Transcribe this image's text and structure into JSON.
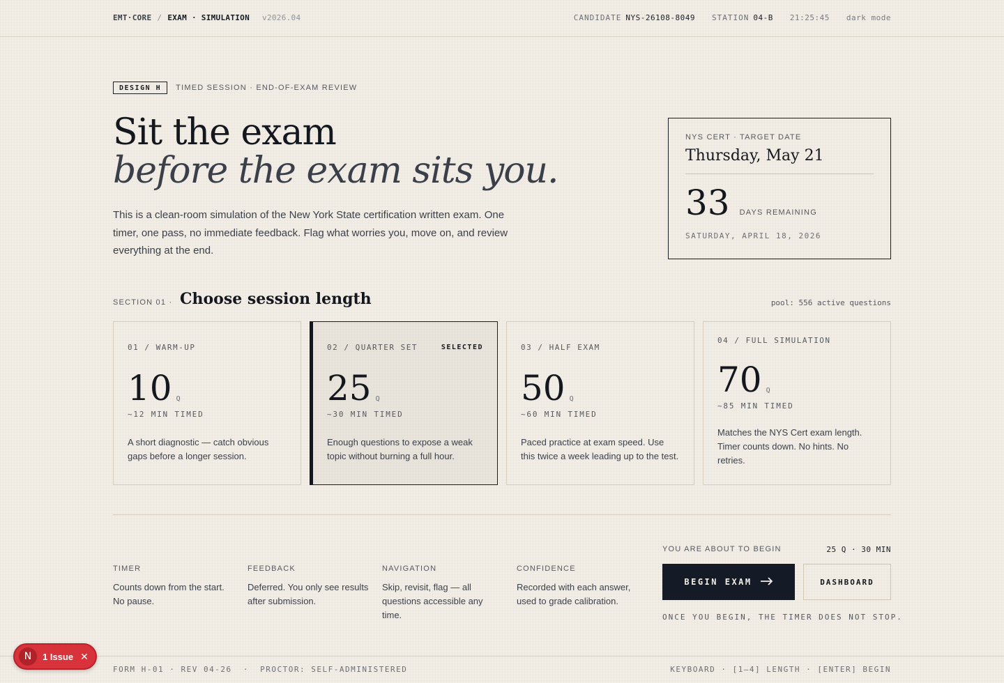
{
  "topbar": {
    "brand": "EMT·CORE",
    "sep": "/",
    "crumb": "EXAM · SIMULATION",
    "version": "v2026.04",
    "candidate_label": "CANDIDATE",
    "candidate_value": "NYS-26108-8049",
    "station_label": "STATION",
    "station_value": "04-B",
    "time": "21:25:45",
    "dark_mode": "dark mode"
  },
  "hero": {
    "tag": "DESIGN H",
    "tagline": "TIMED SESSION · END-OF-EXAM REVIEW",
    "title_line1": "Sit the exam",
    "title_line2": "before the exam sits you.",
    "intro": "This is a clean-room simulation of the New York State certification written exam. One timer, one pass, no immediate feedback. Flag what worries you, move on, and review everything at the end."
  },
  "cert": {
    "label": "NYS CERT · TARGET DATE",
    "date": "Thursday, May 21",
    "days": "33",
    "days_label": "DAYS REMAINING",
    "today": "SATURDAY, APRIL 18, 2026"
  },
  "section": {
    "label": "SECTION 01 ·",
    "title": "Choose session length",
    "pool": "pool: 556 active questions"
  },
  "options": [
    {
      "code": "01 / WARM-UP",
      "count": "10",
      "unit": "Q",
      "time": "~12 MIN TIMED",
      "desc": "A short diagnostic — catch obvious gaps before a longer session."
    },
    {
      "code": "02 / QUARTER SET",
      "badge": "SELECTED",
      "count": "25",
      "unit": "Q",
      "time": "~30 MIN TIMED",
      "desc": "Enough questions to expose a weak topic without burning a full hour."
    },
    {
      "code": "03 / HALF EXAM",
      "count": "50",
      "unit": "Q",
      "time": "~60 MIN TIMED",
      "desc": "Paced practice at exam speed. Use this twice a week leading up to the test."
    },
    {
      "code": "04 / FULL SIMULATION",
      "count": "70",
      "unit": "Q",
      "time": "~85 MIN TIMED",
      "desc": "Matches the NYS Cert exam length. Timer counts down. No hints. No retries."
    }
  ],
  "rules": [
    {
      "key": "TIMER",
      "value": "Counts down from the start. No pause."
    },
    {
      "key": "FEEDBACK",
      "value": "Deferred. You only see results after submission."
    },
    {
      "key": "NAVIGATION",
      "value": "Skip, revisit, flag — all questions accessible any time."
    },
    {
      "key": "CONFIDENCE",
      "value": "Recorded with each answer, used to grade calibration."
    }
  ],
  "begin": {
    "about_label": "YOU ARE ABOUT TO BEGIN",
    "about_value": "25 Q · 30 MIN",
    "begin_label": "BEGIN EXAM",
    "dashboard_label": "DASHBOARD",
    "warning": "ONCE YOU BEGIN, THE TIMER DOES NOT STOP."
  },
  "footer": {
    "left": "FORM H-01 · REV 04-26  ·  PROCTOR: SELF-ADMINISTERED",
    "right": "KEYBOARD · [1–4] LENGTH · [ENTER] BEGIN"
  },
  "issue": {
    "logo": "N",
    "label": "1 Issue",
    "close": "✕"
  },
  "colors": {
    "background": "#f2eee5",
    "ink": "#14171e",
    "button": "#141a26",
    "issue": "#d8323a"
  }
}
